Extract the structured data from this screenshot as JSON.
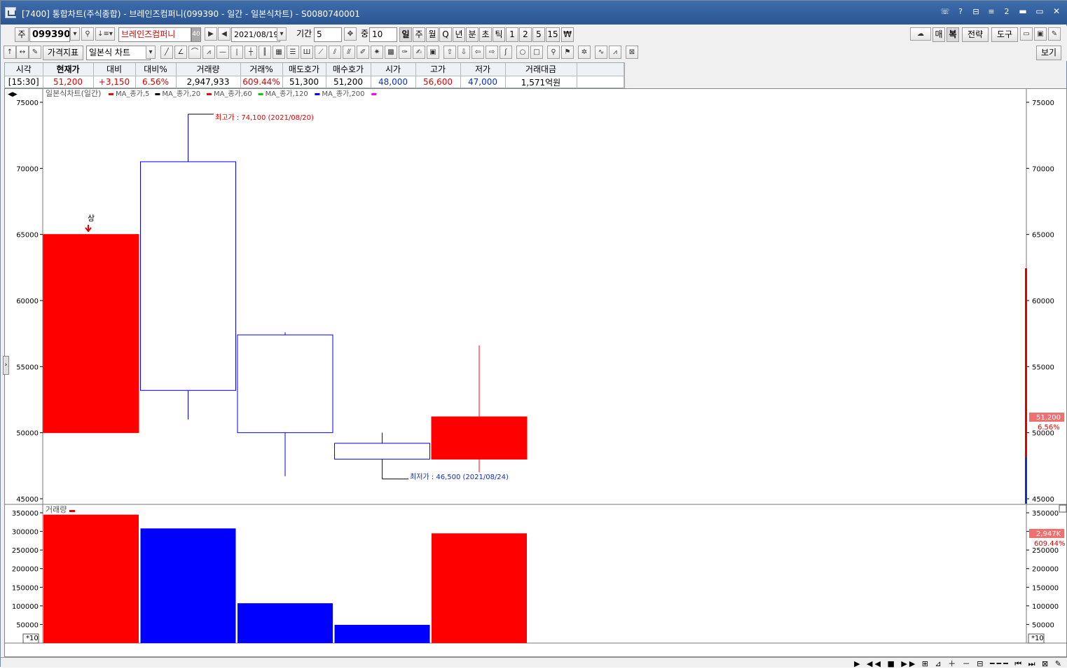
{
  "window": {
    "title": "[7400] 통합차트(주식종합) - 브레인즈컴퍼니(099390 - 일간 - 일본식차트) - S0080740001",
    "title_icons": [
      "☏",
      "?",
      "⊟",
      "≡",
      "2"
    ],
    "min": "▬",
    "max": "▭",
    "close": "✕"
  },
  "toolbar1": {
    "market_code": "주",
    "stock_code": "099390",
    "stock_name": "브레인즈컴퍼니",
    "stock_badge": "40",
    "date": "2021/08/19",
    "period_label": "기간",
    "period_value": "5",
    "count_label": "중",
    "count_value": "10",
    "periods": [
      "일",
      "주",
      "월",
      "Q",
      "년",
      "분",
      "초",
      "틱",
      "1",
      "2",
      "5",
      "15",
      "₩"
    ],
    "right_buttons": [
      "매",
      "복",
      "전략",
      "도구"
    ]
  },
  "toolbar2": {
    "indicator_label": "가격지표",
    "chart_type": "일본식 차트",
    "view_label": "보기"
  },
  "quote": {
    "headers": [
      "시각",
      "현재가",
      "대비",
      "대비%",
      "거래량",
      "거래%",
      "매도호가",
      "매수호가",
      "시가",
      "고가",
      "저가",
      "거래대금"
    ],
    "values": [
      "[15:30]",
      "51,200",
      "+3,150",
      "6.56%",
      "2,947,933",
      "609.44%",
      "51,300",
      "51,200",
      "48,000",
      "56,600",
      "47,000",
      "1,571억원"
    ]
  },
  "chart": {
    "price_legend": "일본식차트(일간)",
    "ma_legends": [
      {
        "label": "MA_종가,5",
        "color": "#ff0000"
      },
      {
        "label": "MA_종가,20",
        "color": "#000000"
      },
      {
        "label": "MA_종가,60",
        "color": "#ff0000"
      },
      {
        "label": "MA_종가,120",
        "color": "#00cc00"
      },
      {
        "label": "MA_종가,200",
        "color": "#0000ff"
      }
    ],
    "last_ma_color": "#ff00ff",
    "high_annotation": "최고가 : 74,100 (2021/08/20)",
    "low_annotation": "최저가 : 46,500 (2021/08/24)",
    "limit_up_mark": "상",
    "price_tag": "51,200",
    "price_tag_pct": "6.56%",
    "volume_legend": "거래량",
    "volume_tag": "2,947K",
    "volume_tag_pct": "609.44%",
    "volume_unit": "*10",
    "up_color": "#ff0000",
    "down_color": "#0000ff"
  },
  "chart_data": {
    "type": "candlestick",
    "price_axis": {
      "ylim": [
        45000,
        76000
      ],
      "ticks": [
        45000,
        50000,
        55000,
        60000,
        65000,
        70000,
        75000
      ]
    },
    "candles": [
      {
        "open": 50000,
        "high": 65000,
        "low": 50000,
        "close": 65000,
        "up": true
      },
      {
        "open": 70500,
        "high": 74100,
        "low": 51000,
        "close": 53200,
        "up": false
      },
      {
        "open": 57400,
        "high": 57600,
        "low": 46700,
        "close": 50000,
        "up": false
      },
      {
        "open": 49200,
        "high": 50000,
        "low": 46500,
        "close": 48000,
        "up": false
      },
      {
        "open": 48000,
        "high": 56600,
        "low": 47000,
        "close": 51200,
        "up": true
      }
    ],
    "volume_axis": {
      "ylim": [
        0,
        360000
      ],
      "ticks": [
        50000,
        100000,
        150000,
        200000,
        250000,
        300000,
        350000
      ]
    },
    "volumes": [
      {
        "value": 345000,
        "up": true
      },
      {
        "value": 308000,
        "up": false
      },
      {
        "value": 107000,
        "up": false
      },
      {
        "value": 49000,
        "up": false
      },
      {
        "value": 294800,
        "up": true
      }
    ]
  }
}
